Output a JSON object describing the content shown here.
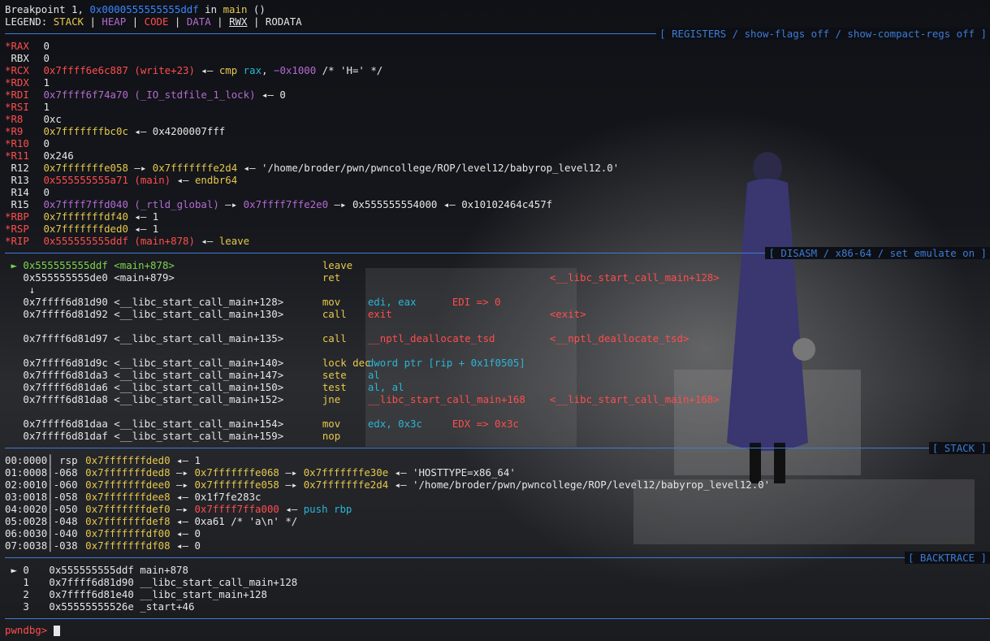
{
  "header": {
    "bp_prefix": "Breakpoint 1, ",
    "bp_addr": "0x0000555555555ddf",
    "bp_in": " in ",
    "bp_func": "main",
    "bp_args": " ()",
    "legend_label": "LEGEND: ",
    "legend_items": [
      "STACK",
      "HEAP",
      "CODE",
      "DATA",
      "RWX",
      "RODATA"
    ]
  },
  "sections": {
    "registers": "[ REGISTERS / show-flags off / show-compact-regs off ]",
    "disasm": "[ DISASM / x86-64 / set emulate on ]",
    "stack": "[ STACK ]",
    "backtrace": "[ BACKTRACE ]"
  },
  "registers": [
    {
      "mark": "*",
      "name": "RAX",
      "v": "0"
    },
    {
      "mark": " ",
      "name": "RBX",
      "v": "0"
    },
    {
      "mark": "*",
      "name": "RCX",
      "v1": "0x7ffff6e6c887 (write+23)",
      "arrow": " ◂— ",
      "ins": "cmp",
      "op1": "rax",
      "sep": ", ",
      "op2": "−0x1000",
      "cm": " /* 'H=' */"
    },
    {
      "mark": "*",
      "name": "RDX",
      "v": "1"
    },
    {
      "mark": "*",
      "name": "RDI",
      "v1": "0x7ffff6f74a70 (_IO_stdfile_1_lock)",
      "arrow": " ◂— ",
      "v2": "0"
    },
    {
      "mark": "*",
      "name": "RSI",
      "v": "1"
    },
    {
      "mark": "*",
      "name": "R8",
      "v": "0xc"
    },
    {
      "mark": "*",
      "name": "R9",
      "v1": "0x7fffffffbc0c",
      "arrow": " ◂— ",
      "v2": "0x4200007fff"
    },
    {
      "mark": "*",
      "name": "R10",
      "v": "0"
    },
    {
      "mark": "*",
      "name": "R11",
      "v": "0x246"
    },
    {
      "mark": " ",
      "name": "R12",
      "v1": "0x7fffffffe058",
      "a1": " —▸ ",
      "v2": "0x7fffffffe2d4",
      "arrow": " ◂— ",
      "v3": "'/home/broder/pwn/pwncollege/ROP/level12/babyrop_level12.0'"
    },
    {
      "mark": " ",
      "name": "R13",
      "v1": "0x555555555a71 (main)",
      "arrow": " ◂— ",
      "v2": "endbr64"
    },
    {
      "mark": " ",
      "name": "R14",
      "v": "0"
    },
    {
      "mark": " ",
      "name": "R15",
      "v1": "0x7ffff7ffd040 (_rtld_global)",
      "a1": " —▸ ",
      "v2": "0x7ffff7ffe2e0",
      "a2": " —▸ ",
      "v3": "0x555555554000",
      "arrow": " ◂— ",
      "v4": "0x10102464c457f"
    },
    {
      "mark": "*",
      "name": "RBP",
      "v1": "0x7fffffffdf40",
      "arrow": " ◂— ",
      "v2": "1"
    },
    {
      "mark": "*",
      "name": "RSP",
      "v1": "0x7fffffffded0",
      "arrow": " ◂— ",
      "v2": "1"
    },
    {
      "mark": "*",
      "name": "RIP",
      "v1": "0x555555555ddf (main+878)",
      "arrow": " ◂— ",
      "v2": "leave"
    }
  ],
  "disasm": [
    {
      "cur": " ► ",
      "addr": "0x555555555ddf",
      "sym": " <main+878>",
      "ins": "leave",
      "ops": "",
      "extra": ""
    },
    {
      "cur": "   ",
      "addr": "0x555555555de0",
      "sym": " <main+879>",
      "ins": "ret",
      "ops": "",
      "extra": "<__libc_start_call_main+128>"
    },
    {
      "cur": "    ↓",
      "addr": "",
      "sym": "",
      "ins": "",
      "ops": "",
      "extra": ""
    },
    {
      "cur": "   ",
      "addr": "0x7ffff6d81d90",
      "sym": " <__libc_start_call_main+128>",
      "ins": "mov",
      "ops": "edi, eax",
      "extra": "EDI => 0"
    },
    {
      "cur": "   ",
      "addr": "0x7ffff6d81d92",
      "sym": " <__libc_start_call_main+130>",
      "ins": "call",
      "ops": "exit",
      "extra": "<exit>"
    },
    {
      "cur": "   ",
      "addr": "0x7ffff6d81d97",
      "sym": " <__libc_start_call_main+135>",
      "ins": "call",
      "ops": "__nptl_deallocate_tsd",
      "extra": "<__nptl_deallocate_tsd>"
    },
    {
      "cur": "   ",
      "addr": "0x7ffff6d81d9c",
      "sym": " <__libc_start_call_main+140>",
      "ins": "lock dec",
      "ops": "dword ptr [rip + 0x1f0505]",
      "extra": ""
    },
    {
      "cur": "   ",
      "addr": "0x7ffff6d81da3",
      "sym": " <__libc_start_call_main+147>",
      "ins": "sete",
      "ops": "al",
      "extra": ""
    },
    {
      "cur": "   ",
      "addr": "0x7ffff6d81da6",
      "sym": " <__libc_start_call_main+150>",
      "ins": "test",
      "ops": "al, al",
      "extra": ""
    },
    {
      "cur": "   ",
      "addr": "0x7ffff6d81da8",
      "sym": " <__libc_start_call_main+152>",
      "ins": "jne",
      "ops": "__libc_start_call_main+168",
      "extra": "<__libc_start_call_main+168>"
    },
    {
      "cur": "   ",
      "addr": "0x7ffff6d81daa",
      "sym": " <__libc_start_call_main+154>",
      "ins": "mov",
      "ops": "edx, 0x3c",
      "extra": "EDX => 0x3c"
    },
    {
      "cur": "   ",
      "addr": "0x7ffff6d81daf",
      "sym": " <__libc_start_call_main+159>",
      "ins": "nop",
      "ops": "",
      "extra": ""
    }
  ],
  "stack": [
    {
      "idx": "00:0000",
      "off": " rsp",
      "a": "0x7fffffffded0",
      "rest": [
        " ◂— ",
        "1"
      ]
    },
    {
      "idx": "01:0008",
      "off": "-068",
      "a": "0x7fffffffded8",
      "chain": [
        "0x7fffffffe068",
        "0x7fffffffe30e"
      ],
      "rest": [
        " ◂— ",
        "'HOSTTYPE=x86_64'"
      ]
    },
    {
      "idx": "02:0010",
      "off": "-060",
      "a": "0x7fffffffdee0",
      "chain": [
        "0x7fffffffe058",
        "0x7fffffffe2d4"
      ],
      "rest": [
        " ◂— ",
        "'/home/broder/pwn/pwncollege/ROP/level12/babyrop_level12.0'"
      ]
    },
    {
      "idx": "03:0018",
      "off": "-058",
      "a": "0x7fffffffdee8",
      "rest": [
        " ◂— ",
        "0x1f7fe283c"
      ]
    },
    {
      "idx": "04:0020",
      "off": "-050",
      "a": "0x7fffffffdef0",
      "code": "0x7ffff7ffa000",
      "rest": [
        " ◂— ",
        "push rbp"
      ]
    },
    {
      "idx": "05:0028",
      "off": "-048",
      "a": "0x7fffffffdef8",
      "rest": [
        " ◂— ",
        "0xa61 /* 'a\\n' */"
      ]
    },
    {
      "idx": "06:0030",
      "off": "-040",
      "a": "0x7fffffffdf00",
      "rest": [
        " ◂— ",
        "0"
      ]
    },
    {
      "idx": "07:0038",
      "off": "-038",
      "a": "0x7fffffffdf08",
      "rest": [
        " ◂— ",
        "0"
      ]
    }
  ],
  "backtrace": [
    {
      "cur": " ► ",
      "n": "0",
      "addr": "0x555555555ddf",
      "sym": "main+878"
    },
    {
      "cur": "   ",
      "n": "1",
      "addr": "0x7ffff6d81d90",
      "sym": "__libc_start_call_main+128"
    },
    {
      "cur": "   ",
      "n": "2",
      "addr": "0x7ffff6d81e40",
      "sym": "__libc_start_main+128"
    },
    {
      "cur": "   ",
      "n": "3",
      "addr": "0x55555555526e",
      "sym": "_start+46"
    }
  ],
  "prompt": "pwndbg>"
}
